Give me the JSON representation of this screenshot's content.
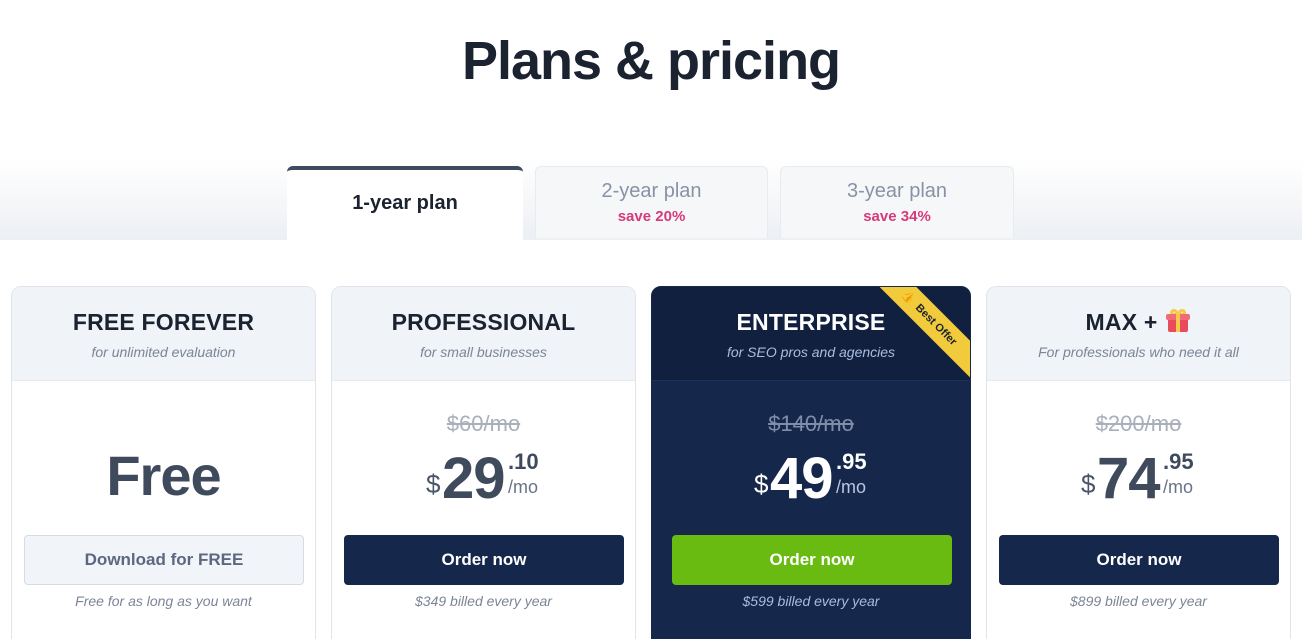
{
  "page": {
    "title": "Plans & pricing"
  },
  "tabs": [
    {
      "label": "1-year plan",
      "save": ""
    },
    {
      "label": "2-year plan",
      "save": "save 20%"
    },
    {
      "label": "3-year plan",
      "save": "save 34%"
    }
  ],
  "plans": [
    {
      "name": "FREE FOREVER",
      "subtitle": "for unlimited evaluation",
      "price_text": "Free",
      "cta": "Download for FREE",
      "billing": "Free for as long as you want"
    },
    {
      "name": "PROFESSIONAL",
      "subtitle": "for small businesses",
      "old_price": "$60/mo",
      "currency": "$",
      "price_main": "29",
      "price_cents": ".10",
      "period": "/mo",
      "cta": "Order now",
      "billing": "$349 billed every year"
    },
    {
      "name": "ENTERPRISE",
      "subtitle": "for SEO pros and agencies",
      "badge": "Best Offer",
      "old_price": "$140/mo",
      "currency": "$",
      "price_main": "49",
      "price_cents": ".95",
      "period": "/mo",
      "cta": "Order now",
      "billing": "$599 billed every year"
    },
    {
      "name": "MAX +",
      "subtitle": "For professionals who need it all",
      "old_price": "$200/mo",
      "currency": "$",
      "price_main": "74",
      "price_cents": ".95",
      "period": "/mo",
      "cta": "Order now",
      "billing": "$899 billed every year"
    }
  ],
  "icons": {
    "badge_icon": "thumbs-up-icon",
    "max_icon": "gift-icon"
  },
  "colors": {
    "navy": "#15274a",
    "green": "#69bb12",
    "save_accent": "#d63a7a",
    "ribbon": "#f2cb3c"
  }
}
